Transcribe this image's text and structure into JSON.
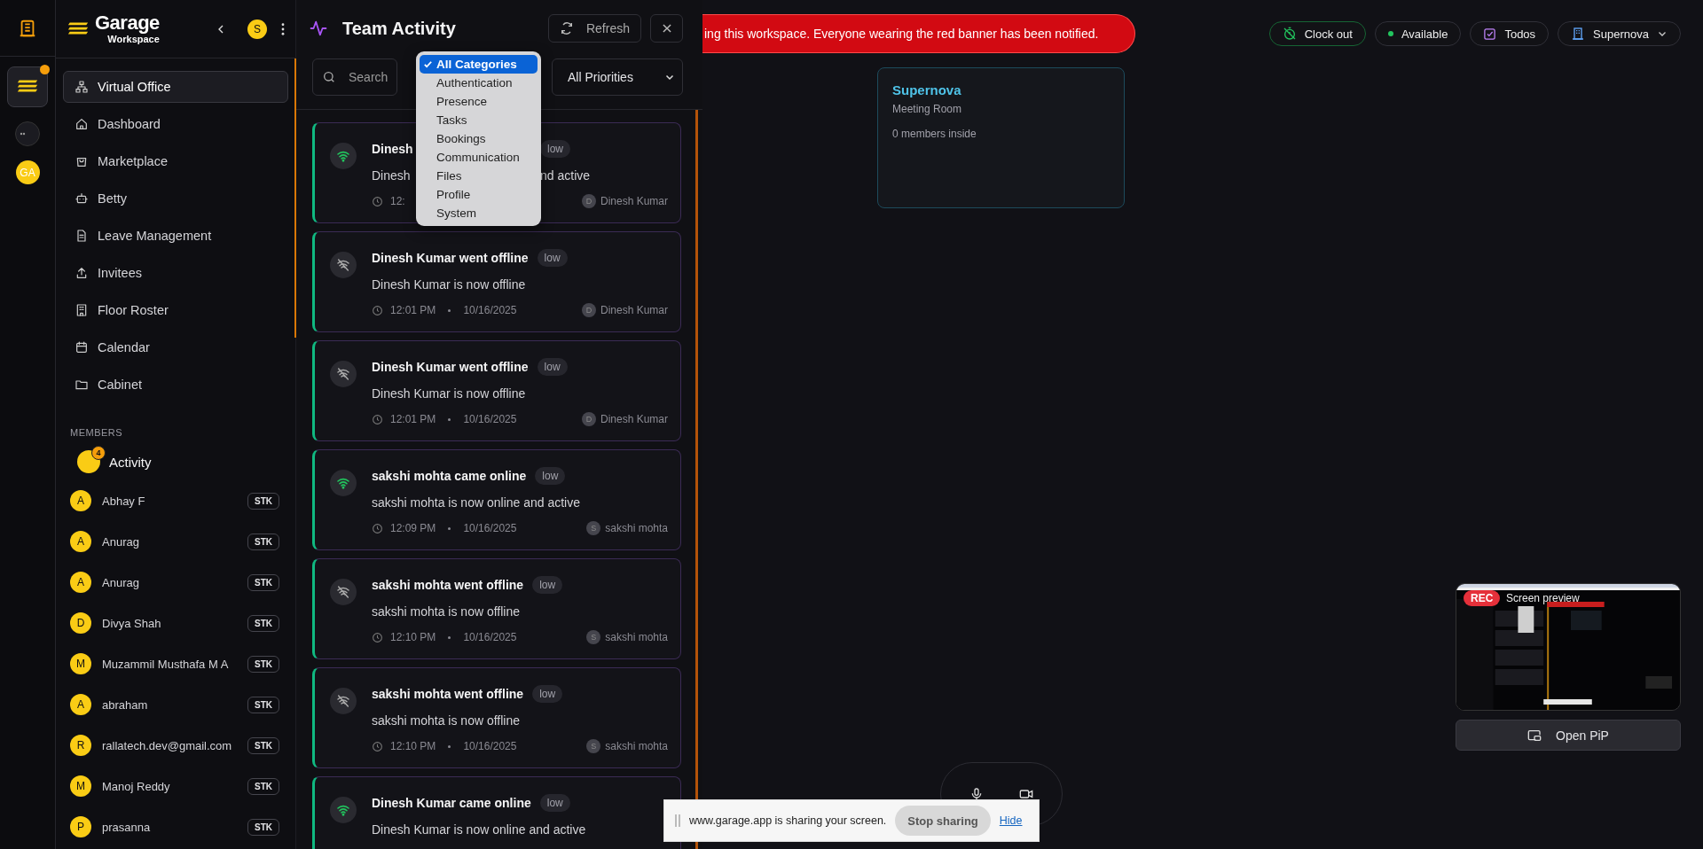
{
  "rail": {
    "has_notification": true,
    "avatar": "GA"
  },
  "sidebar": {
    "brand": "Garage",
    "brand_sub": "Workspace",
    "user_avatar": "S",
    "nav": [
      {
        "label": "Virtual Office",
        "selected": true
      },
      {
        "label": "Dashboard",
        "selected": false
      },
      {
        "label": "Marketplace",
        "selected": false
      },
      {
        "label": "Betty",
        "selected": false
      },
      {
        "label": "Leave Management",
        "selected": false
      },
      {
        "label": "Invitees",
        "selected": false
      },
      {
        "label": "Floor Roster",
        "selected": false
      },
      {
        "label": "Calendar",
        "selected": false
      },
      {
        "label": "Cabinet",
        "selected": false
      }
    ],
    "members_heading": "MEMBERS",
    "activity": {
      "label": "Activity",
      "count": "4"
    },
    "members": [
      {
        "initial": "A",
        "name": "Abhay F",
        "tag": "STK"
      },
      {
        "initial": "A",
        "name": "Anurag",
        "tag": "STK"
      },
      {
        "initial": "A",
        "name": "Anurag",
        "tag": "STK"
      },
      {
        "initial": "D",
        "name": "Divya Shah",
        "tag": "STK"
      },
      {
        "initial": "M",
        "name": "Muzammil Musthafa M A",
        "tag": "STK"
      },
      {
        "initial": "A",
        "name": "abraham",
        "tag": "STK"
      },
      {
        "initial": "R",
        "name": "rallatech.dev@gmail.com",
        "tag": "STK"
      },
      {
        "initial": "M",
        "name": "Manoj Reddy",
        "tag": "STK"
      },
      {
        "initial": "P",
        "name": "prasanna",
        "tag": "STK"
      }
    ]
  },
  "activity_panel": {
    "title": "Team Activity",
    "refresh": "Refresh",
    "search": {
      "placeholder": "Search"
    },
    "priority_filter": "All Priorities",
    "category_menu": [
      {
        "label": "All Categories",
        "selected": true
      },
      {
        "label": "Authentication",
        "selected": false
      },
      {
        "label": "Presence",
        "selected": false
      },
      {
        "label": "Tasks",
        "selected": false
      },
      {
        "label": "Bookings",
        "selected": false
      },
      {
        "label": "Communication",
        "selected": false
      },
      {
        "label": "Files",
        "selected": false
      },
      {
        "label": "Profile",
        "selected": false
      },
      {
        "label": "System",
        "selected": false
      }
    ],
    "events": [
      {
        "kind": "online",
        "covered": true,
        "title": "Dinesh",
        "priority": "low",
        "message": "Dinesh",
        "message_tail": "nd active",
        "time": "12:",
        "author_initial": "D",
        "author": "Dinesh Kumar"
      },
      {
        "kind": "offline",
        "covered": false,
        "title": "Dinesh Kumar went offline",
        "priority": "low",
        "message": "Dinesh Kumar is now offline",
        "time": "12:01 PM",
        "date": "10/16/2025",
        "author_initial": "D",
        "author": "Dinesh Kumar"
      },
      {
        "kind": "offline",
        "covered": false,
        "title": "Dinesh Kumar went offline",
        "priority": "low",
        "message": "Dinesh Kumar is now offline",
        "time": "12:01 PM",
        "date": "10/16/2025",
        "author_initial": "D",
        "author": "Dinesh Kumar"
      },
      {
        "kind": "online",
        "covered": false,
        "title": "sakshi mohta came online",
        "priority": "low",
        "message": "sakshi mohta is now online and active",
        "time": "12:09 PM",
        "date": "10/16/2025",
        "author_initial": "S",
        "author": "sakshi mohta"
      },
      {
        "kind": "offline",
        "covered": false,
        "title": "sakshi mohta went offline",
        "priority": "low",
        "message": "sakshi mohta is now offline",
        "time": "12:10 PM",
        "date": "10/16/2025",
        "author_initial": "S",
        "author": "sakshi mohta"
      },
      {
        "kind": "offline",
        "covered": false,
        "title": "sakshi mohta went offline",
        "priority": "low",
        "message": "sakshi mohta is now offline",
        "time": "12:10 PM",
        "date": "10/16/2025",
        "author_initial": "S",
        "author": "sakshi mohta"
      },
      {
        "kind": "online",
        "covered": false,
        "title": "Dinesh Kumar came online",
        "priority": "low",
        "message": "Dinesh Kumar is now online and active"
      }
    ]
  },
  "banner": {
    "text": "ing this workspace. Everyone wearing the red banner has been notified."
  },
  "top_bar": {
    "clock_out": "Clock out",
    "status": {
      "label": "Available",
      "color": "#22c55e"
    },
    "todos": "Todos",
    "workspace": "Supernova"
  },
  "rooms": [
    {
      "name": "Supernova",
      "type": "Meeting Room",
      "occupancy": "0 members inside"
    }
  ],
  "preview": {
    "badge": "REC",
    "label": "Screen preview",
    "button": "Open PiP"
  },
  "share_bar": {
    "text": "www.garage.app is sharing your screen.",
    "stop": "Stop sharing",
    "hide": "Hide"
  }
}
